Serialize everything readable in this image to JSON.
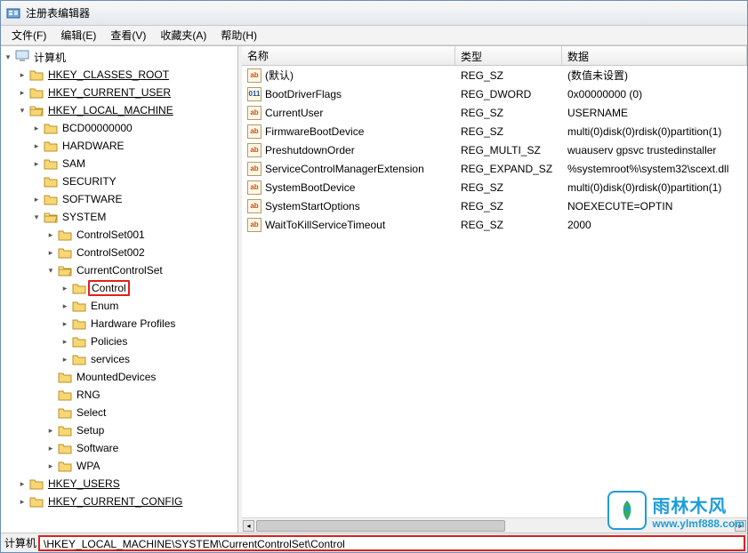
{
  "window": {
    "title": "注册表编辑器"
  },
  "menu": {
    "file": "文件(F)",
    "edit": "编辑(E)",
    "view": "查看(V)",
    "favorites": "收藏夹(A)",
    "help": "帮助(H)"
  },
  "tree": {
    "root": "计算机",
    "hkcr": "HKEY_CLASSES_ROOT",
    "hkcu": "HKEY_CURRENT_USER",
    "hklm": "HKEY_LOCAL_MACHINE",
    "hklm_children": {
      "bcd": "BCD00000000",
      "hardware": "HARDWARE",
      "sam": "SAM",
      "security": "SECURITY",
      "software": "SOFTWARE",
      "system": "SYSTEM"
    },
    "system_children": {
      "cs001": "ControlSet001",
      "cs002": "ControlSet002",
      "ccs": "CurrentControlSet",
      "mounted": "MountedDevices",
      "rng": "RNG",
      "select": "Select",
      "setup": "Setup",
      "software2": "Software",
      "wpa": "WPA"
    },
    "ccs_children": {
      "control": "Control",
      "enum": "Enum",
      "hwprofiles": "Hardware Profiles",
      "policies": "Policies",
      "services": "services"
    },
    "hku": "HKEY_USERS",
    "hkcc": "HKEY_CURRENT_CONFIG"
  },
  "columns": {
    "name": "名称",
    "type": "类型",
    "data": "数据"
  },
  "values": [
    {
      "icon": "str",
      "name": "(默认)",
      "type": "REG_SZ",
      "data": "(数值未设置)"
    },
    {
      "icon": "bin",
      "name": "BootDriverFlags",
      "type": "REG_DWORD",
      "data": "0x00000000 (0)"
    },
    {
      "icon": "str",
      "name": "CurrentUser",
      "type": "REG_SZ",
      "data": "USERNAME"
    },
    {
      "icon": "str",
      "name": "FirmwareBootDevice",
      "type": "REG_SZ",
      "data": "multi(0)disk(0)rdisk(0)partition(1)"
    },
    {
      "icon": "str",
      "name": "PreshutdownOrder",
      "type": "REG_MULTI_SZ",
      "data": "wuauserv gpsvc trustedinstaller"
    },
    {
      "icon": "str",
      "name": "ServiceControlManagerExtension",
      "type": "REG_EXPAND_SZ",
      "data": "%systemroot%\\system32\\scext.dll"
    },
    {
      "icon": "str",
      "name": "SystemBootDevice",
      "type": "REG_SZ",
      "data": "multi(0)disk(0)rdisk(0)partition(1)"
    },
    {
      "icon": "str",
      "name": "SystemStartOptions",
      "type": "REG_SZ",
      "data": " NOEXECUTE=OPTIN"
    },
    {
      "icon": "str",
      "name": "WaitToKillServiceTimeout",
      "type": "REG_SZ",
      "data": "2000"
    }
  ],
  "status": {
    "label": "计算机",
    "path": "\\HKEY_LOCAL_MACHINE\\SYSTEM\\CurrentControlSet\\Control"
  },
  "watermark": {
    "cn": "雨林木风",
    "url": "www.ylmf888.com"
  }
}
